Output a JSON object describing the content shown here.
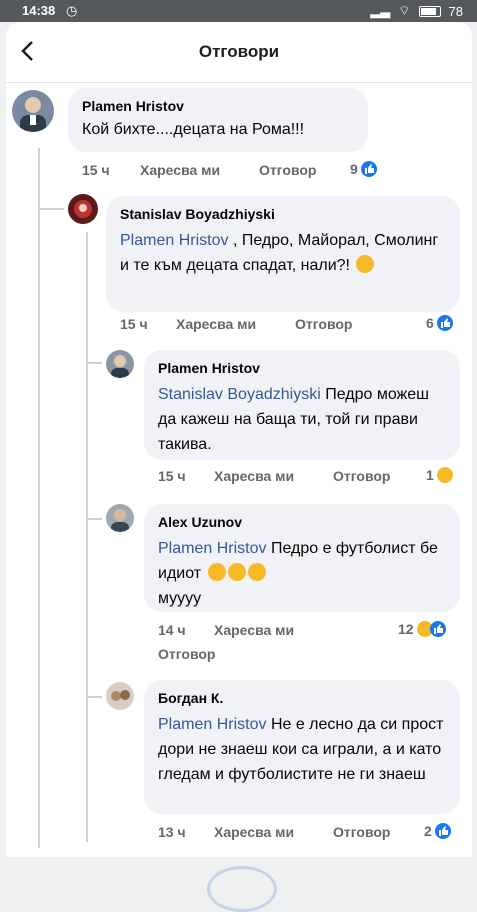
{
  "status": {
    "time": "14:38",
    "battery": "78"
  },
  "header": {
    "title": "Отговори"
  },
  "comments": [
    {
      "name": "Plamen Hristov",
      "mention": "",
      "text": "Кой бихте....децата на Рома!!!",
      "time": "15 ч",
      "like": "Харесва ми",
      "reply": "Отговор",
      "count": "9"
    },
    {
      "name": "Stanislav Boyadzhiyski",
      "mention": "Plamen Hristov",
      "text": ", Педро, Майорал, Смолинг и те към децата спадат, нали?!",
      "time": "15 ч",
      "like": "Харесва ми",
      "reply": "Отговор",
      "count": "6"
    },
    {
      "name": "Plamen Hristov",
      "mention": "Stanislav Boyadzhiyski",
      "text": "Педро можеш да кажеш на баща ти, той ги прави такива.",
      "time": "15 ч",
      "like": "Харесва ми",
      "reply": "Отговор",
      "count": "1"
    },
    {
      "name": "Alex Uzunov",
      "mention": "Plamen Hristov",
      "text": "Педро е футболист бе идиот",
      "text2": "муууу",
      "time": "14 ч",
      "like": "Харесва ми",
      "reply": "Отговор",
      "count": "12"
    },
    {
      "name": "Богдан К.",
      "mention": "Plamen Hristov",
      "text": "Не е лесно да си прост дори не знаеш кои са играли, а и като гледам и футболистите не ги знаеш",
      "time": "13 ч",
      "like": "Харесва ми",
      "reply": "Отговор",
      "count": "2"
    }
  ],
  "colors": {
    "like": "#1877f2",
    "haha": "#f7b928",
    "mention": "#385898"
  }
}
